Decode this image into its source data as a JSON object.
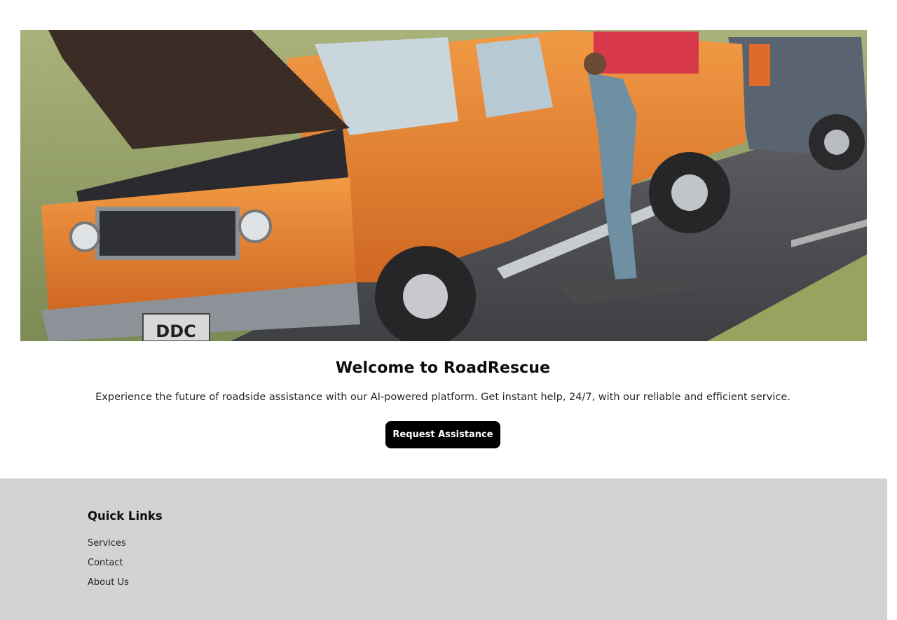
{
  "hero": {
    "image_alt": "Mechanic working on an orange pickup truck with its hood open on the roadside",
    "plate_text": "DDC"
  },
  "main": {
    "title": "Welcome to RoadRescue",
    "tagline": "Experience the future of roadside assistance with our AI-powered platform. Get instant help, 24/7, with our reliable and efficient service.",
    "cta_label": "Request Assistance"
  },
  "footer": {
    "heading": "Quick Links",
    "links": [
      {
        "label": "Services"
      },
      {
        "label": "Contact"
      },
      {
        "label": "About Us"
      }
    ]
  },
  "colors": {
    "cta_bg": "#000000",
    "footer_bg": "#d3d3d3",
    "truck_orange": "#e07a2c"
  }
}
